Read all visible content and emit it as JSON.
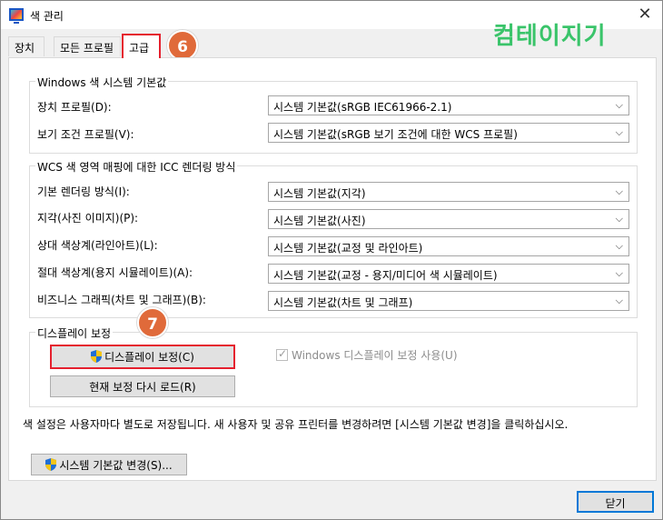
{
  "window": {
    "title": "색 관리",
    "close_symbol": "✕"
  },
  "watermark": "컴테이지기",
  "tabs": [
    {
      "label": "장치"
    },
    {
      "label": "모든 프로필"
    },
    {
      "label": "고급"
    }
  ],
  "annotations": {
    "step6": "6",
    "step7": "7"
  },
  "windows_defaults": {
    "legend": "Windows 색 시스템 기본값",
    "rows": [
      {
        "label": "장치 프로필(D):",
        "value": "시스템 기본값(sRGB IEC61966-2.1)"
      },
      {
        "label": "보기 조건 프로필(V):",
        "value": "시스템 기본값(sRGB 보기 조건에 대한 WCS 프로필)"
      }
    ]
  },
  "wcs_mapping": {
    "legend": "WCS 색 영역 매핑에 대한 ICC 렌더링 방식",
    "rows": [
      {
        "label": "기본 렌더링 방식(I):",
        "value": "시스템 기본값(지각)"
      },
      {
        "label": "지각(사진 이미지)(P):",
        "value": "시스템 기본값(사진)"
      },
      {
        "label": "상대 색상계(라인아트)(L):",
        "value": "시스템 기본값(교정 및 라인아트)"
      },
      {
        "label": "절대 색상계(용지 시뮬레이트)(A):",
        "value": "시스템 기본값(교정 - 용지/미디어 색 시뮬레이트)"
      },
      {
        "label": "비즈니스 그래픽(차트 및 그래프)(B):",
        "value": "시스템 기본값(차트 및 그래프)"
      }
    ]
  },
  "display_calibration": {
    "legend": "디스플레이 보정",
    "calibrate_button": "디스플레이 보정(C)",
    "reload_button": "현재 보정 다시 로드(R)",
    "use_checkbox": "Windows 디스플레이 보정 사용(U)",
    "use_checked": true
  },
  "info_text": "색 설정은 사용자마다 별도로 저장됩니다. 새 사용자 및 공유 프린터를 변경하려면 [시스템 기본값 변경]을 클릭하십시오.",
  "change_defaults_button": "시스템 기본값 변경(S)...",
  "close_button": "닫기",
  "colors": {
    "highlight": "#e5202e",
    "badge": "#e06a3a",
    "watermark": "#3ac46a",
    "focus": "#0078d7"
  },
  "icons": {
    "shield": "uac-shield-icon",
    "dropdown": "chevron-down-icon"
  }
}
